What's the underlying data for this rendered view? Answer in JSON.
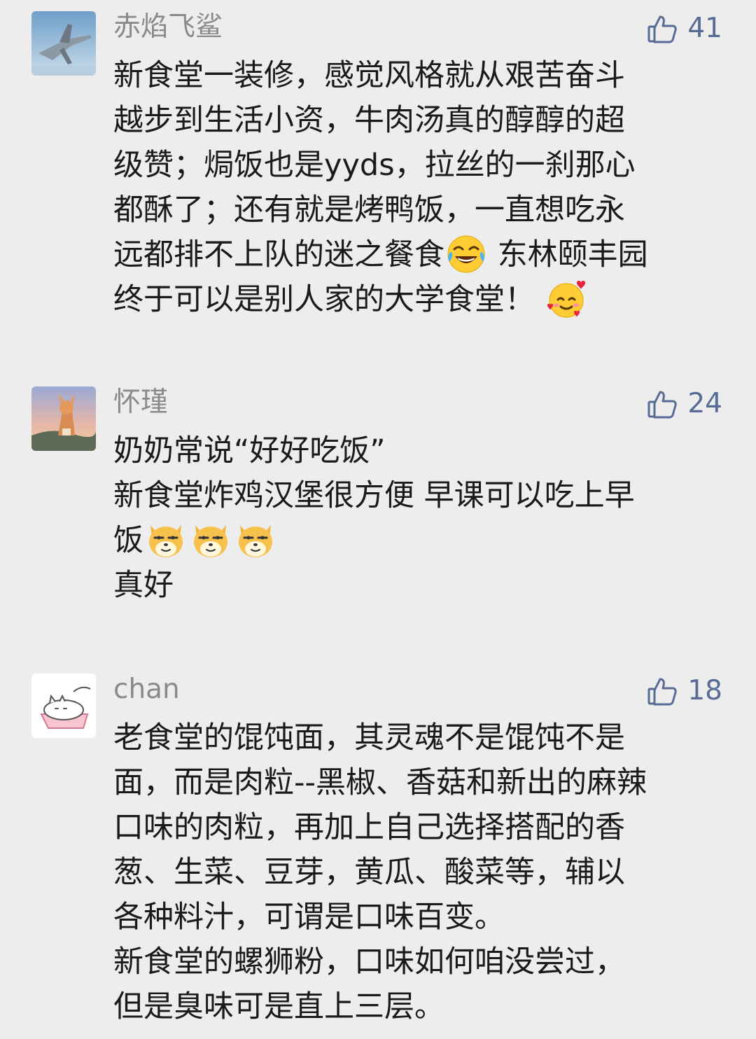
{
  "comments": [
    {
      "username": "赤焰飞鲨",
      "likes": "41",
      "lines": [
        "新食堂一装修，感觉风格就从艰苦奋斗",
        "越步到生活小资，牛肉汤真的醇醇的超",
        "级赞；焗饭也是yyds，拉丝的一刹那心",
        "都酥了；还有就是烤鸭饭，一直想吃永",
        "远都排不上队的迷之餐食",
        "东林颐丰园",
        "终于可以是别人家的大学食堂！"
      ],
      "emojis": [
        "tears-of-joy",
        "smiling-face-with-hearts"
      ]
    },
    {
      "username": "怀瑾",
      "likes": "24",
      "lines": [
        "奶奶常说“好好吃饭”",
        "新食堂炸鸡汉堡很方便 早课可以吃上早",
        "饭",
        "真好"
      ],
      "emojis": [
        "smirk-dog",
        "smirk-dog",
        "smirk-dog"
      ]
    },
    {
      "username": "chan",
      "likes": "18",
      "lines": [
        "老食堂的馄饨面，其灵魂不是馄饨不是",
        "面，而是肉粒--黑椒、香菇和新出的麻辣",
        "口味的肉粒，再加上自己选择搭配的香",
        "葱、生菜、豆芽，黄瓜、酸菜等，辅以",
        "各种料汁，可谓是口味百变。",
        "新食堂的螺狮粉，口味如何咱没尝过，",
        "但是臭味可是直上三层。"
      ]
    }
  ],
  "icons": {
    "like": "thumbs-up-icon"
  },
  "colors": {
    "background": "#ededed",
    "username": "#8a8a8a",
    "like_accent": "#576b95",
    "text": "#1a1a1a"
  }
}
